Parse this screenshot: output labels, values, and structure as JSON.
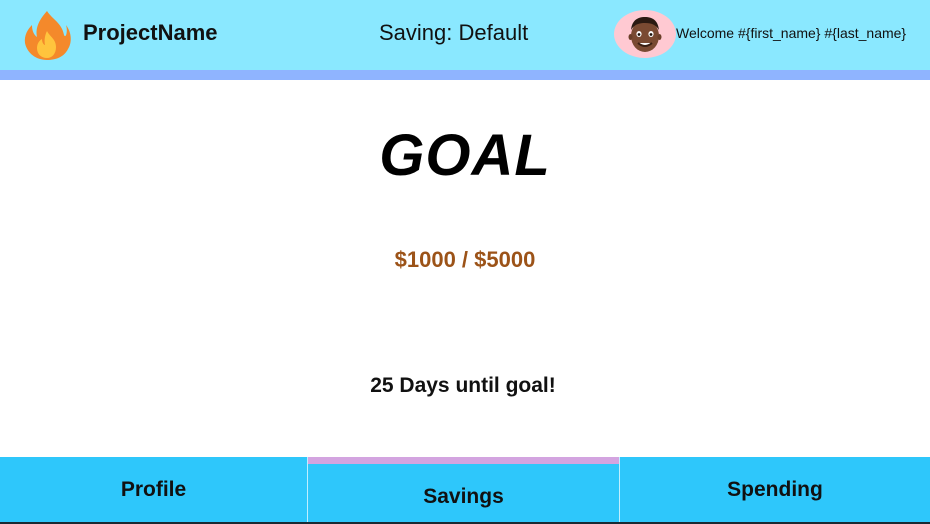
{
  "header": {
    "logo_icon": "fire-icon",
    "project_name": "ProjectName",
    "saving_label": "Saving: Default",
    "avatar_icon": "user-avatar-icon",
    "welcome_text": "Welcome #{first_name} #{last_name}"
  },
  "main": {
    "title": "GOAL",
    "amount": "$1000 / $5000",
    "days_until": "25 Days until goal!"
  },
  "nav": {
    "active_tab": "Savings",
    "tabs": [
      {
        "label": "Profile"
      },
      {
        "label": "Savings"
      },
      {
        "label": "Spending"
      }
    ]
  },
  "colors": {
    "header_bg": "#8ae8ff",
    "header_stripe": "#8fb4ff",
    "nav_bg": "#2ec7fb",
    "active_indicator": "#d3a4e0",
    "amount_text": "#9c5318",
    "avatar_bg": "#ffc9d2"
  }
}
